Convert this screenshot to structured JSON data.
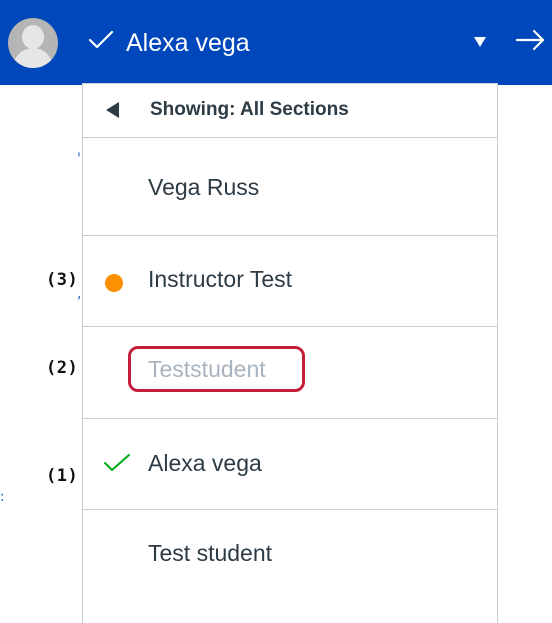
{
  "header": {
    "user_name": "Alexa vega",
    "colors": {
      "background": "#0047bb",
      "text": "#ffffff"
    },
    "icons": {
      "avatar": "avatar-icon",
      "check": "checkmark-icon",
      "dropdown": "caret-down-icon",
      "next": "arrow-right-icon"
    }
  },
  "dropdown": {
    "section_label": "Showing: All Sections",
    "items": [
      {
        "label": "Vega Russ",
        "status": ""
      },
      {
        "label": "Instructor Test",
        "status": "in-progress"
      },
      {
        "label": "Teststudent",
        "status": "disabled"
      },
      {
        "label": "Alexa vega",
        "status": "selected"
      },
      {
        "label": "Test student",
        "status": ""
      }
    ],
    "colors": {
      "border": "#c7cdd1",
      "text": "#2d3b45",
      "muted_text": "#a7b4bf",
      "dot": "#fc9000",
      "check": "#00ac18",
      "highlight": "#c41e3a"
    }
  },
  "callouts": [
    "(3)",
    "(2)",
    "(1)"
  ]
}
